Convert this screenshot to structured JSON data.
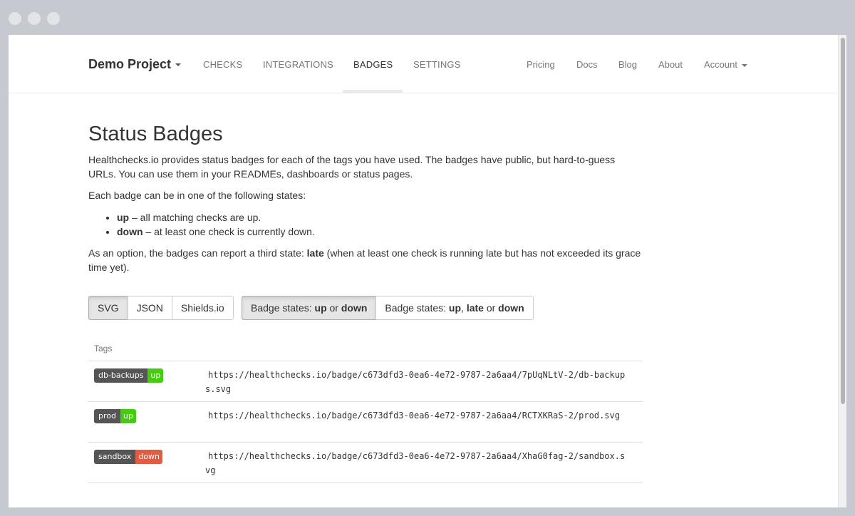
{
  "colors": {
    "badge_label": "#555555",
    "state_up": "#4c1",
    "state_down": "#e05d44"
  },
  "nav": {
    "project": "Demo Project",
    "tabs": [
      "CHECKS",
      "INTEGRATIONS",
      "BADGES",
      "SETTINGS"
    ],
    "active_tab": "BADGES",
    "right": [
      "Pricing",
      "Docs",
      "Blog",
      "About"
    ],
    "account": "Account"
  },
  "page": {
    "title": "Status Badges",
    "intro": "Healthchecks.io provides status badges for each of the tags you have used. The badges have public, but hard-to-guess URLs. You can use them in your READMEs, dashboards or status pages.",
    "states_intro": "Each badge can be in one of the following states:",
    "states": [
      {
        "name": "up",
        "desc": " – all matching checks are up."
      },
      {
        "name": "down",
        "desc": " – at least one check is currently down."
      }
    ],
    "option_text_1": "As an option, the badges can report a third state: ",
    "option_bold": "late",
    "option_text_2": " (when at least one check is running late but has not exceeded its grace time yet)."
  },
  "format_buttons": [
    {
      "label": "SVG",
      "active": true
    },
    {
      "label": "JSON",
      "active": false
    },
    {
      "label": "Shields.io",
      "active": false
    }
  ],
  "state_buttons": {
    "b1": {
      "prefix": "Badge states: ",
      "s1": "up",
      "sep1": " or ",
      "s2": "down",
      "active": true
    },
    "b2": {
      "prefix": "Badge states: ",
      "s1": "up",
      "sep1": ", ",
      "s2": "late",
      "sep2": " or ",
      "s3": "down",
      "active": false
    }
  },
  "table": {
    "header": "Tags",
    "rows": [
      {
        "tag": "db-backups",
        "state": "up",
        "url": "https://healthchecks.io/badge/c673dfd3-0ea6-4e72-9787-2a6aa4/7pUqNLtV-2/db-backups.svg"
      },
      {
        "tag": "prod",
        "state": "up",
        "url": "https://healthchecks.io/badge/c673dfd3-0ea6-4e72-9787-2a6aa4/RCTXKRaS-2/prod.svg"
      },
      {
        "tag": "sandbox",
        "state": "down",
        "url": "https://healthchecks.io/badge/c673dfd3-0ea6-4e72-9787-2a6aa4/XhaG0fag-2/sandbox.svg"
      }
    ]
  }
}
